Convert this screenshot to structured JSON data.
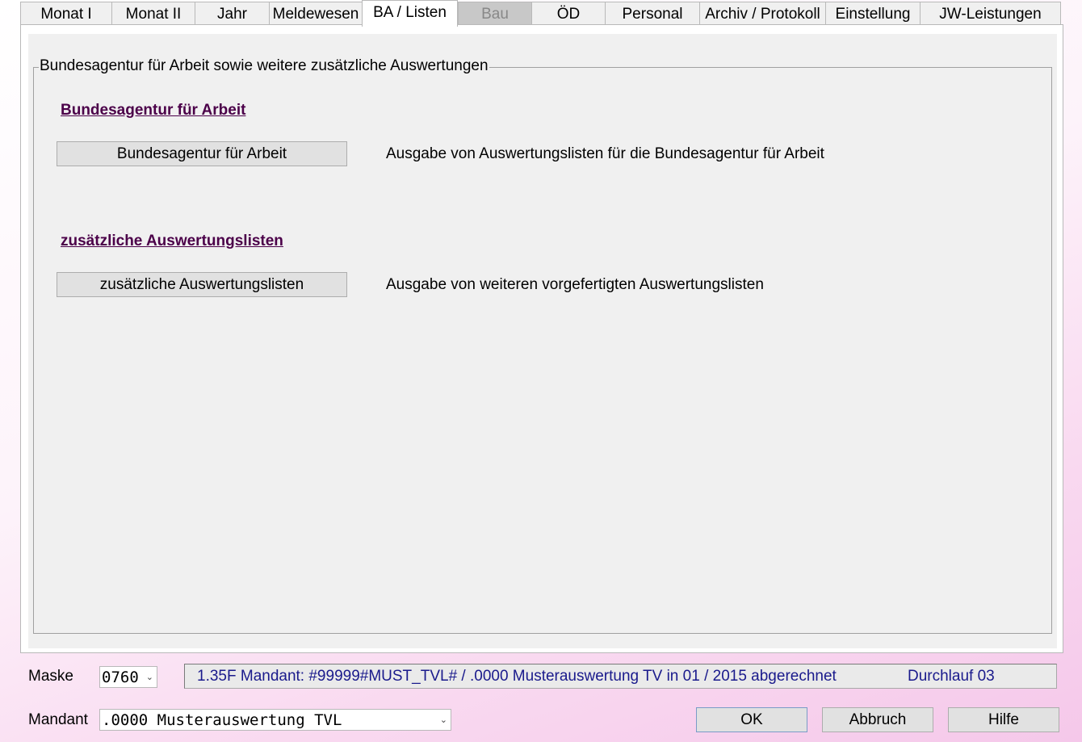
{
  "tabs": [
    {
      "label": "Monat I"
    },
    {
      "label": "Monat II"
    },
    {
      "label": "Jahr"
    },
    {
      "label": "Meldewesen"
    },
    {
      "label": "BA / Listen"
    },
    {
      "label": "Bau"
    },
    {
      "label": "ÖD"
    },
    {
      "label": "Personal"
    },
    {
      "label": "Archiv / Protokoll"
    },
    {
      "label": "Einstellung"
    },
    {
      "label": "JW-Leistungen"
    }
  ],
  "active_tab": "BA / Listen",
  "disabled_tab": "Bau",
  "group": {
    "title": "Bundesagentur für Arbeit sowie weitere zusätzliche Auswertungen",
    "sections": [
      {
        "heading": "Bundesagentur für Arbeit",
        "button_label": "Bundesagentur für Arbeit",
        "description": "Ausgabe von Auswertungslisten für die Bundesagentur für Arbeit"
      },
      {
        "heading": "zusätzliche Auswertungslisten",
        "button_label": "zusätzliche Auswertungslisten",
        "description": "Ausgabe von weiteren vorgefertigten Auswertungslisten"
      }
    ]
  },
  "footer": {
    "maske_label": "Maske",
    "maske_value": "0760",
    "status_text": "1.35F Mandant: #99999#MUST_TVL# / .0000 Musterauswertung TV in 01 / 2015 abgerechnet",
    "status_run": "Durchlauf 03",
    "mandant_label": "Mandant",
    "mandant_value": ".0000 Musterauswertung TVL",
    "ok_label": "OK",
    "cancel_label": "Abbruch",
    "help_label": "Hilfe"
  },
  "icons": {
    "dropdown": "chevron-down-icon"
  },
  "colors": {
    "link": "#4b0049",
    "status_text": "#1a1a8c",
    "disabled_tab": "#c8c8c8"
  }
}
